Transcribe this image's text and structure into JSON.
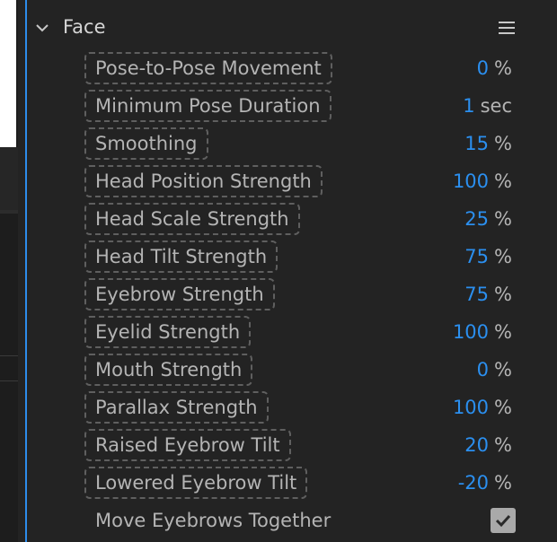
{
  "panel": {
    "title": "Face"
  },
  "rows": [
    {
      "label": "Pose-to-Pose Movement",
      "value": "0",
      "unit": "%"
    },
    {
      "label": "Minimum Pose Duration",
      "value": "1",
      "unit": "sec"
    },
    {
      "label": "Smoothing",
      "value": "15",
      "unit": "%"
    },
    {
      "label": "Head Position Strength",
      "value": "100",
      "unit": "%"
    },
    {
      "label": "Head Scale Strength",
      "value": "25",
      "unit": "%"
    },
    {
      "label": "Head Tilt Strength",
      "value": "75",
      "unit": "%"
    },
    {
      "label": "Eyebrow Strength",
      "value": "75",
      "unit": "%"
    },
    {
      "label": "Eyelid Strength",
      "value": "100",
      "unit": "%"
    },
    {
      "label": "Mouth Strength",
      "value": "0",
      "unit": "%"
    },
    {
      "label": "Parallax Strength",
      "value": "100",
      "unit": "%"
    },
    {
      "label": "Raised Eyebrow Tilt",
      "value": "20",
      "unit": "%"
    },
    {
      "label": "Lowered Eyebrow Tilt",
      "value": "-20",
      "unit": "%"
    }
  ],
  "checkbox_row": {
    "label": "Move Eyebrows Together",
    "checked": true
  },
  "colors": {
    "accent": "#2b8fef",
    "background": "#232323",
    "label_text": "#b4b4b4"
  },
  "icons": {
    "collapse": "chevron-down-icon",
    "menu": "hamburger-menu-icon",
    "check": "checkmark-icon"
  }
}
